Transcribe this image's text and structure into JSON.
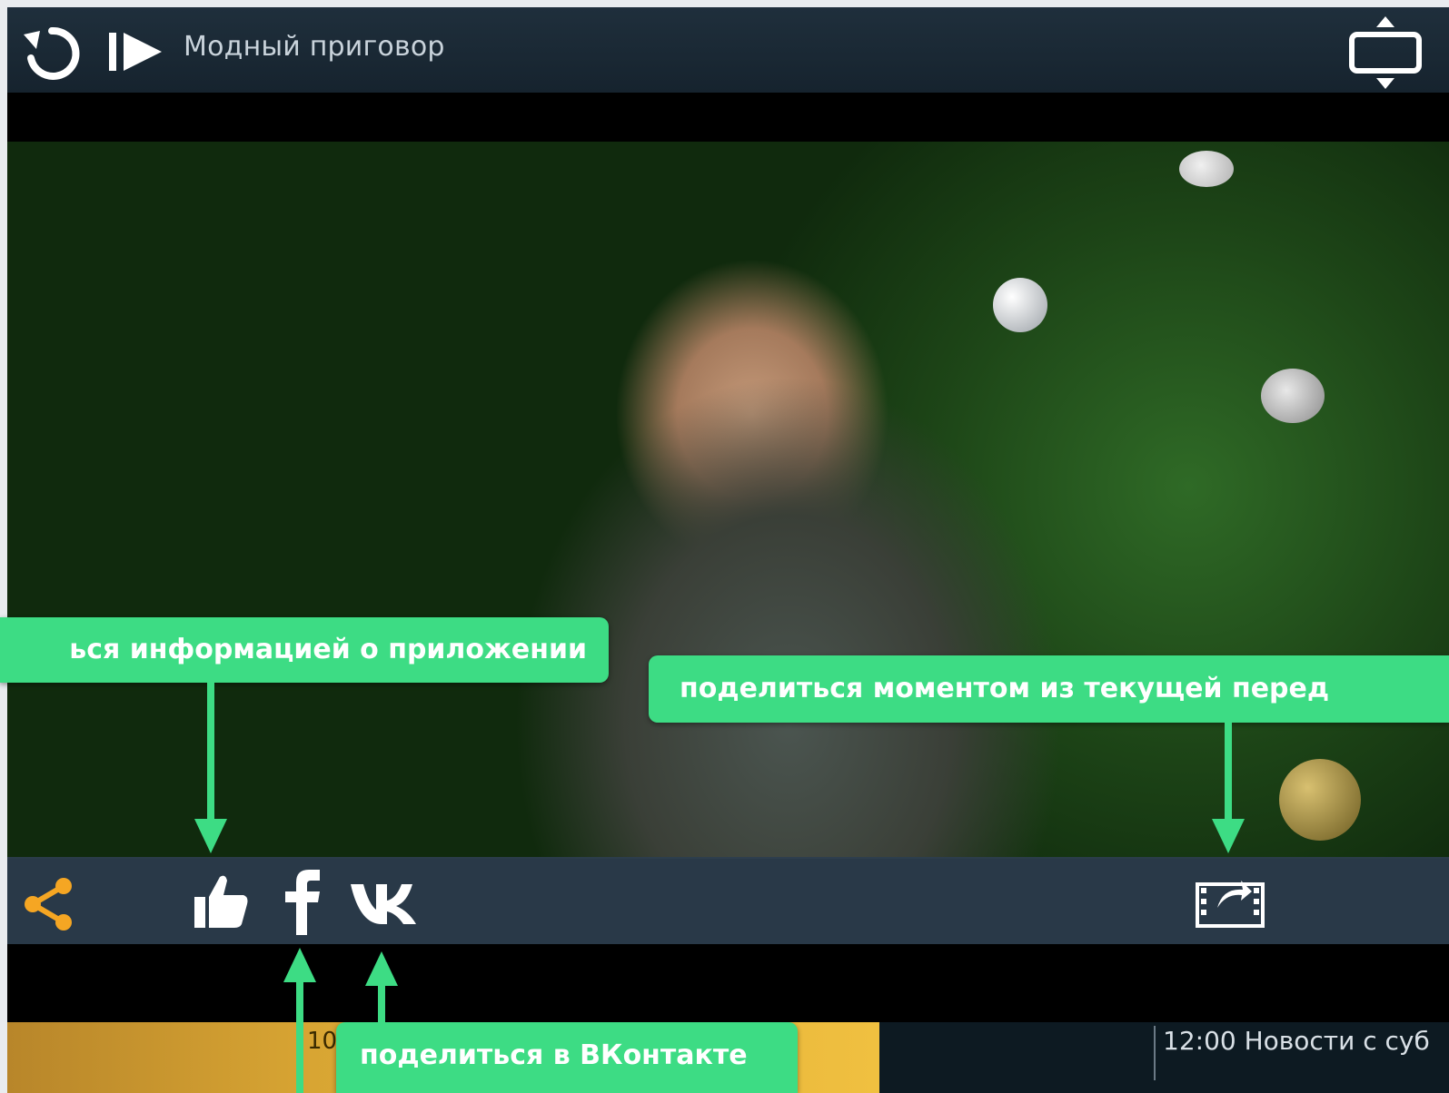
{
  "player": {
    "title": "Модный приговор"
  },
  "schedule": {
    "current_time": "10:",
    "next_program": "12:00 Новости с суб"
  },
  "callouts": {
    "info": "ься информацией о приложении",
    "moment": "поделиться моментом из текущей перед",
    "vk": "поделиться в ВКонтакте"
  },
  "icons": {
    "replay": "replay-icon",
    "play": "play-icon",
    "resize": "resize-icon",
    "share": "share-icon",
    "like": "like-icon",
    "facebook": "facebook-icon",
    "vk": "vk-icon",
    "moment": "moment-capture-icon"
  },
  "colors": {
    "accent": "#3ddc84",
    "share_icon": "#f5a623",
    "bar_bg": "#1f2f3c",
    "progress": "#f0c040"
  }
}
